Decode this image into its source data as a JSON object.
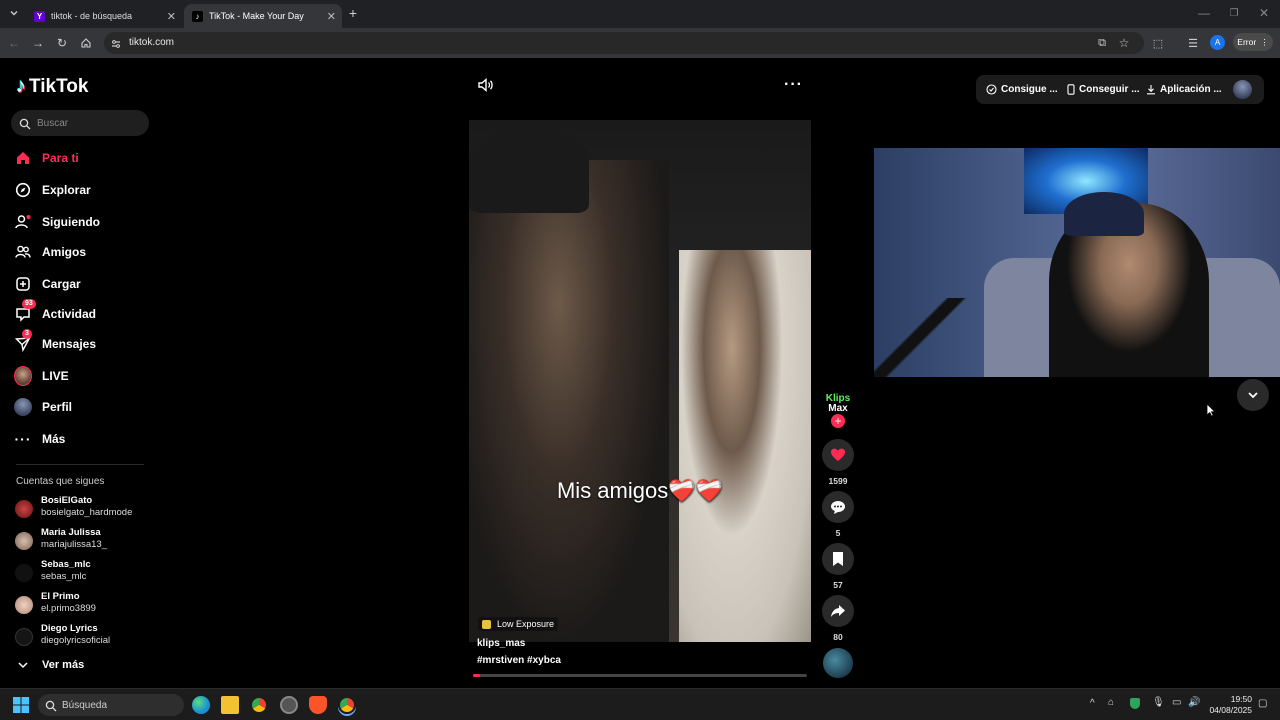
{
  "browser": {
    "tabs": [
      {
        "title": "tiktok - de búsqueda",
        "icon": "yahoo-icon",
        "active": false
      },
      {
        "title": "TikTok - Make Your Day",
        "icon": "tiktok-icon",
        "active": true
      }
    ],
    "url": "tiktok.com",
    "profile_initial": "A",
    "error_label": "Error"
  },
  "app": {
    "logo": "TikTok",
    "search_placeholder": "Buscar"
  },
  "nav": [
    {
      "label": "Para ti",
      "icon": "home-icon",
      "active": true
    },
    {
      "label": "Explorar",
      "icon": "compass-icon"
    },
    {
      "label": "Siguiendo",
      "icon": "following-icon"
    },
    {
      "label": "Amigos",
      "icon": "friends-icon"
    },
    {
      "label": "Cargar",
      "icon": "upload-icon"
    },
    {
      "label": "Actividad",
      "icon": "activity-icon",
      "badge": "93"
    },
    {
      "label": "Mensajes",
      "icon": "messages-icon",
      "badge": "3"
    },
    {
      "label": "LIVE",
      "icon": "live-icon"
    },
    {
      "label": "Perfil",
      "icon": "profile-icon"
    },
    {
      "label": "Más",
      "icon": "more-icon"
    }
  ],
  "following": {
    "title": "Cuentas que sigues",
    "accounts": [
      {
        "name": "BosiElGato",
        "handle": "bosielgato_hardmode"
      },
      {
        "name": "Maria Julissa",
        "handle": "mariajulissa13_"
      },
      {
        "name": "Sebas_mlc",
        "handle": "sebas_mlc"
      },
      {
        "name": "El Primo",
        "handle": "el.primo3899"
      },
      {
        "name": "Diego Lyrics",
        "handle": "diegolyricsoficial"
      }
    ],
    "see_more": "Ver más"
  },
  "video": {
    "caption": "Mis amigos❤️‍🩹❤️‍🩹",
    "low_exposure": "Low Exposure",
    "author": "klips_mas",
    "tags": "#mrstiven  #xybca",
    "progress": 0.02,
    "creator_logo": {
      "line1": "Klips",
      "line2": "Max"
    }
  },
  "actions": {
    "likes": "1599",
    "comments": "5",
    "saves": "57",
    "shares": "80"
  },
  "top_buttons": [
    {
      "label": "Consigue ...",
      "icon": "coin-icon"
    },
    {
      "label": "Conseguir ...",
      "icon": "phone-icon"
    },
    {
      "label": "Aplicación ...",
      "icon": "download-icon"
    }
  ],
  "taskbar": {
    "search": "Búsqueda",
    "time": "19:50",
    "date": "04/08/2025"
  }
}
